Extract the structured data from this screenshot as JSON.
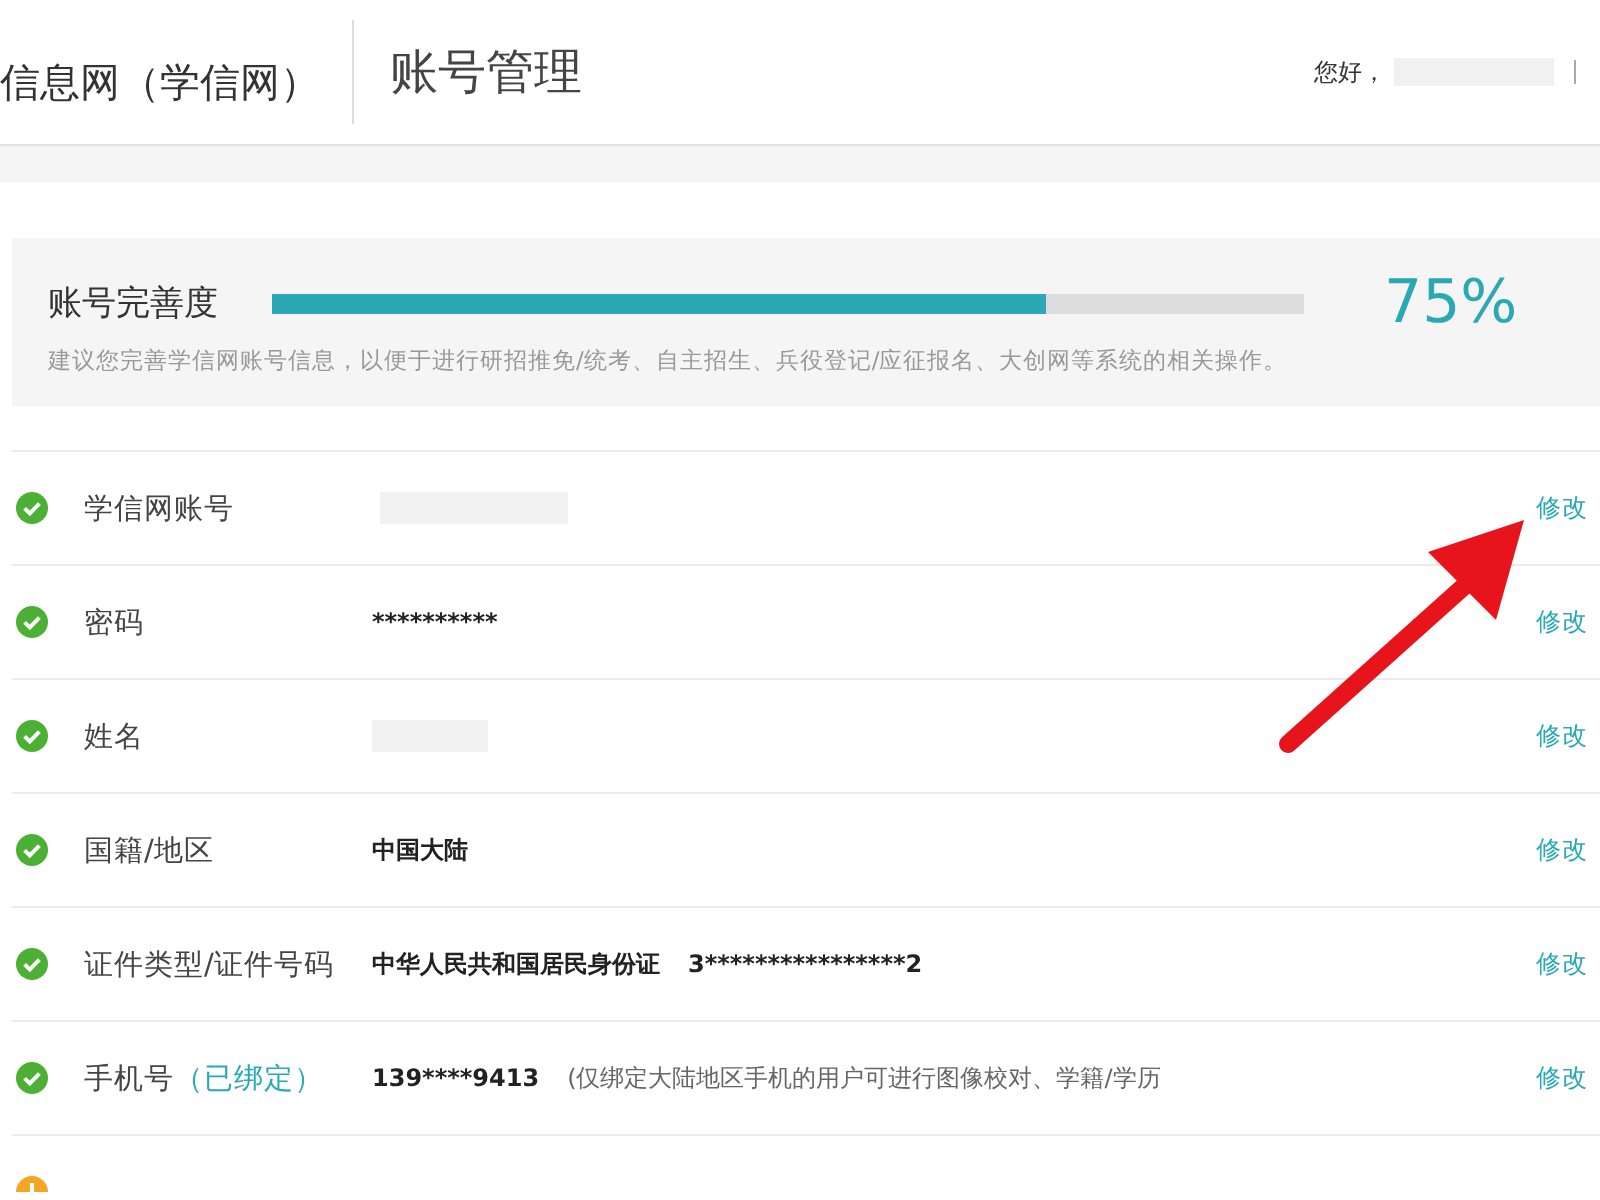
{
  "header": {
    "logo": "信息网（学信网）",
    "title": "账号管理",
    "greeting": "您好，"
  },
  "completeness": {
    "label": "账号完善度",
    "level": 0.75,
    "percent": "75%",
    "hint": "建议您完善学信网账号信息，以便于进行研招推免/统考、自主招生、兵役登记/应征报名、大创网等系统的相关操作。"
  },
  "rows": [
    {
      "verified": true,
      "label": "学信网账号",
      "kind": "redacted",
      "action": "修改"
    },
    {
      "verified": true,
      "label": "密码",
      "kind": "text",
      "value": "**********",
      "action": "修改"
    },
    {
      "verified": true,
      "label": "姓名",
      "kind": "redacted",
      "action": "修改"
    },
    {
      "verified": true,
      "label": "国籍/地区",
      "kind": "text",
      "value": "中国大陆",
      "action": "修改"
    },
    {
      "verified": true,
      "label": "证件类型/证件号码",
      "kind": "text",
      "value": "中华人民共和国居民身份证",
      "value2": "3****************2",
      "action": "修改"
    },
    {
      "verified": true,
      "label": "手机号",
      "tag": "（已绑定）",
      "kind": "text",
      "value": "139****9413",
      "note": "(仅绑定大陆地区手机的用户可进行图像校对、学籍/学历",
      "action": "修改"
    },
    {
      "verified": false,
      "kind": "empty"
    }
  ]
}
